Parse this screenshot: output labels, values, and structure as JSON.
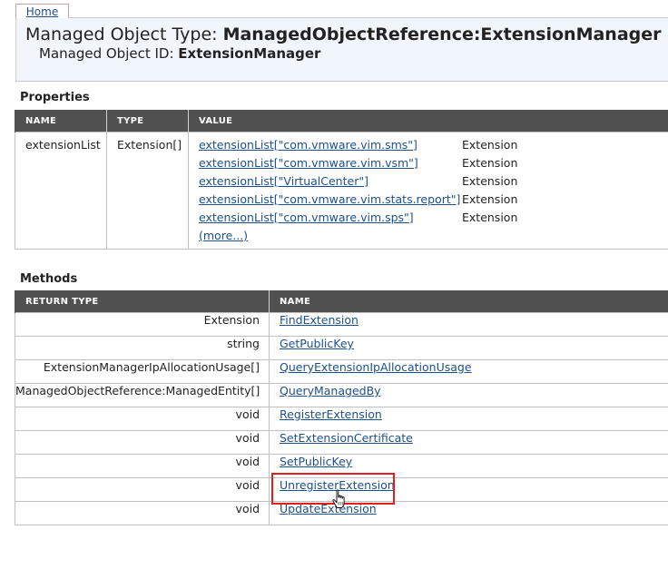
{
  "nav": {
    "home": "Home"
  },
  "header": {
    "type_label": "Managed Object Type: ",
    "type_value": "ManagedObjectReference:ExtensionManager",
    "id_label": "Managed Object ID: ",
    "id_value": "ExtensionManager"
  },
  "properties": {
    "title": "Properties",
    "columns": [
      "NAME",
      "TYPE",
      "VALUE"
    ],
    "rows": [
      {
        "name": "extensionList",
        "type": "Extension[]",
        "values": [
          {
            "link": "extensionList[\"com.vmware.vim.sms\"]",
            "type": "Extension"
          },
          {
            "link": "extensionList[\"com.vmware.vim.vsm\"]",
            "type": "Extension"
          },
          {
            "link": "extensionList[\"VirtualCenter\"]",
            "type": "Extension"
          },
          {
            "link": "extensionList[\"com.vmware.vim.stats.report\"]",
            "type": "Extension"
          },
          {
            "link": "extensionList[\"com.vmware.vim.sps\"]",
            "type": "Extension"
          }
        ],
        "more": "(more...)"
      }
    ]
  },
  "methods": {
    "title": "Methods",
    "columns": [
      "RETURN TYPE",
      "NAME"
    ],
    "rows": [
      {
        "return_type": "Extension",
        "name": "FindExtension"
      },
      {
        "return_type": "string",
        "name": "GetPublicKey"
      },
      {
        "return_type": "ExtensionManagerIpAllocationUsage[]",
        "name": "QueryExtensionIpAllocationUsage"
      },
      {
        "return_type": "ManagedObjectReference:ManagedEntity[]",
        "name": "QueryManagedBy"
      },
      {
        "return_type": "void",
        "name": "RegisterExtension"
      },
      {
        "return_type": "void",
        "name": "SetExtensionCertificate"
      },
      {
        "return_type": "void",
        "name": "SetPublicKey"
      },
      {
        "return_type": "void",
        "name": "UnregisterExtension"
      },
      {
        "return_type": "void",
        "name": "UpdateExtension"
      }
    ]
  },
  "colors": {
    "highlight": "#e0201e",
    "header_bg": "#505050",
    "link": "#1d4f8c"
  },
  "icons": {
    "cursor": "hand-pointer-icon"
  }
}
